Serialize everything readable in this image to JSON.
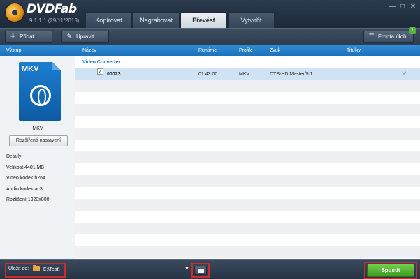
{
  "app": {
    "brand": "DVDFab",
    "version": "9.1.1.1 (29/11/2013)"
  },
  "tabs": [
    {
      "label": "Kopírovat",
      "active": false
    },
    {
      "label": "Nagrabovat",
      "active": false
    },
    {
      "label": "Převést",
      "active": true
    },
    {
      "label": "Vytvořit",
      "active": false
    }
  ],
  "window_controls": {
    "minimize": "—",
    "maximize": "□",
    "close": "✕"
  },
  "toolbar": {
    "add_label": "Přidat",
    "edit_label": "Upravit",
    "queue_label": "Fronta úloh",
    "queue_count": "1"
  },
  "left_panel": {
    "header": "Výstup",
    "format_icon_text": "MKV",
    "format_label": "MKV",
    "advanced_button": "Rozšířená nastavení",
    "details_title": "Detaily",
    "details": [
      "Velikost:4401 MB",
      "Video kodek:h264",
      "Audio kodek:ac3",
      "Rozlišení:1920x800"
    ]
  },
  "grid": {
    "columns": [
      "Název",
      "Runtime",
      "Profile",
      "Zvuk",
      "Titulky"
    ],
    "group_label": "Video Converter",
    "rows": [
      {
        "checked": true,
        "name": "00023",
        "runtime": "01:43:00",
        "profile": "MKV",
        "audio": "DTS-HD Master/5.1",
        "subtitles": ""
      }
    ]
  },
  "bottom": {
    "save_label": "Uložit do:",
    "save_path": "E:\\Test\\",
    "start_label": "Spustit"
  },
  "colors": {
    "accent_blue": "#1c78c8",
    "highlight_red": "#d22a2a",
    "start_green": "#4cb22e"
  }
}
